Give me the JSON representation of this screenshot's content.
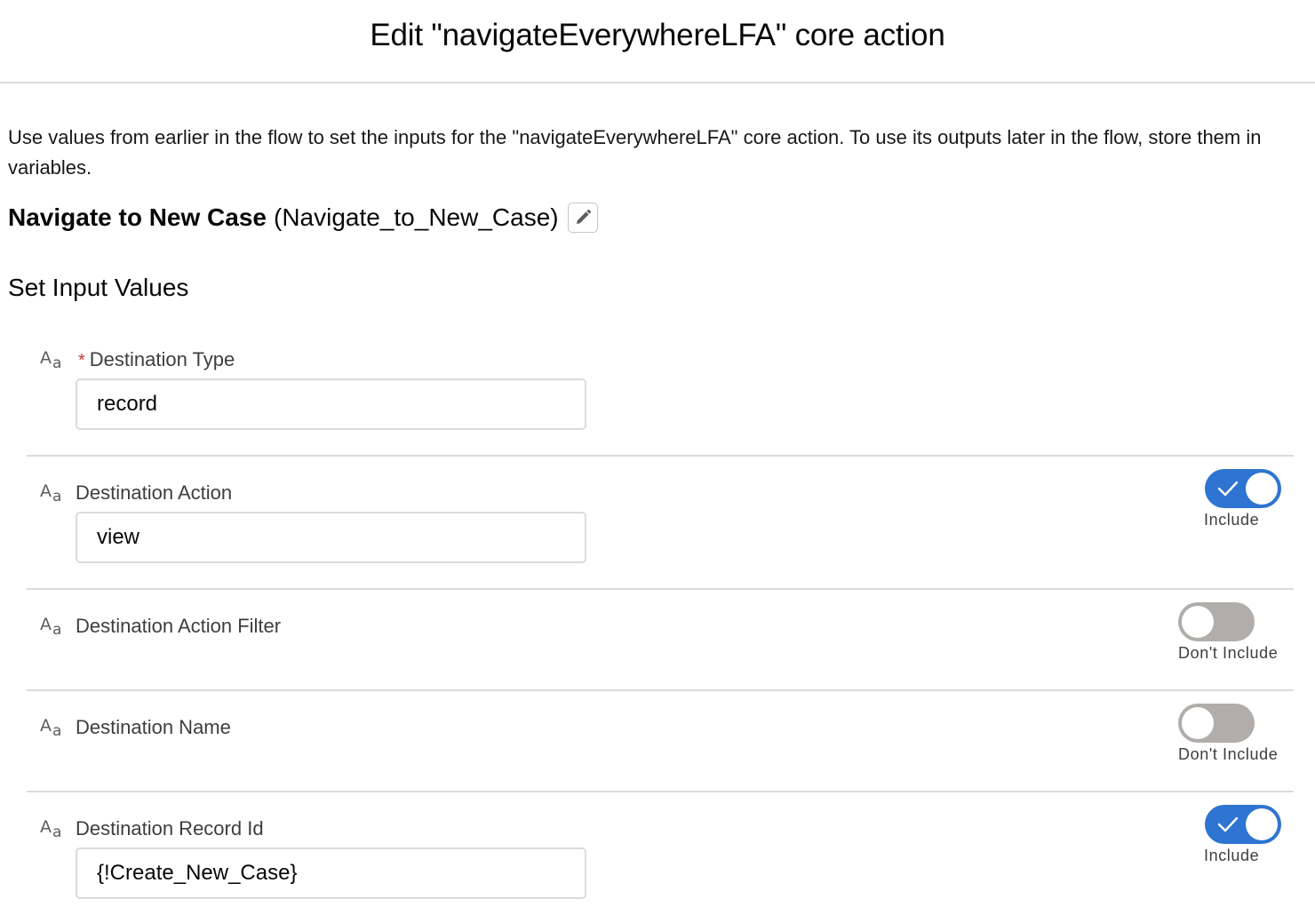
{
  "header": {
    "title": "Edit \"navigateEverywhereLFA\" core action"
  },
  "intro": "Use values from earlier in the flow to set the inputs for the \"navigateEverywhereLFA\" core action. To use its outputs later in the flow, store them in variables.",
  "action": {
    "label": "Navigate to New Case",
    "api_name": "(Navigate_to_New_Case)"
  },
  "section_title": "Set Input Values",
  "type_icon": {
    "big": "A",
    "small": "a"
  },
  "fields": [
    {
      "label": "Destination Type",
      "required": "*",
      "value": "record"
    },
    {
      "label": "Destination Action",
      "value": "view",
      "toggle_label": "Include"
    },
    {
      "label": "Destination Action Filter",
      "toggle_label": "Don't Include"
    },
    {
      "label": "Destination Name",
      "toggle_label": "Don't Include"
    },
    {
      "label": "Destination Record Id",
      "value": "{!Create_New_Case}",
      "toggle_label": "Include"
    }
  ],
  "icons": {
    "edit": "pencil-icon",
    "type": "text-type-icon",
    "check": "check-icon"
  },
  "colors": {
    "toggle_on": "#2e74d1",
    "toggle_off": "#b0adab",
    "required": "#c23934"
  }
}
